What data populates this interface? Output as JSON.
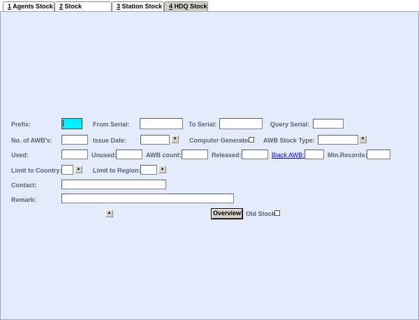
{
  "tabs": [
    {
      "key": "1",
      "label": " Agents Stock",
      "active": false
    },
    {
      "key": "2",
      "label": " Stock Overview",
      "active": false
    },
    {
      "key": "3",
      "label": " Station Stock",
      "active": false
    },
    {
      "key": "4",
      "label": " HDQ Stock",
      "active": true
    }
  ],
  "form": {
    "prefix_label": "Prefix:",
    "prefix_value": "",
    "from_serial_label": "From Serial:",
    "from_serial_value": "",
    "to_serial_label": "To Serial:",
    "to_serial_value": "",
    "query_serial_label": "Query Serial:",
    "query_serial_value": "",
    "no_awbs_label": "No. of AWB's:",
    "no_awbs_value": "",
    "issue_date_label": "Issue Date:",
    "issue_date_value": "",
    "computer_generated_label": "Computer Generated",
    "computer_generated_checked": false,
    "awb_stock_type_label": "AWB Stock Type:",
    "awb_stock_type_value": "",
    "used_label": "Used:",
    "used_value": "",
    "unused_label": "Unused:",
    "unused_value": "",
    "awb_count_label": "AWB count:",
    "awb_count_value": "",
    "released_label": "Released:",
    "released_value": "",
    "black_awb_label": "Black AWB:",
    "black_awb_value": "",
    "min_records_label": "Min.Records:",
    "min_records_value": "",
    "limit_country_label": "Limit to Country:",
    "limit_country_value": "",
    "limit_region_label": "Limit to Region:",
    "limit_region_value": "",
    "contact_label": "Contact:",
    "contact_value": "",
    "remark_label": "Remark:",
    "remark_value": "",
    "overview_button": "Overview",
    "old_stock_label": "Old Stock",
    "old_stock_checked": false
  },
  "icons": {
    "spin_up": "▲",
    "dropdown": "▼"
  },
  "colors": {
    "panel_bg": "#e4ecfc",
    "focus_field": "#00f0ff",
    "label": "#5a6478",
    "link": "#0000ff"
  }
}
